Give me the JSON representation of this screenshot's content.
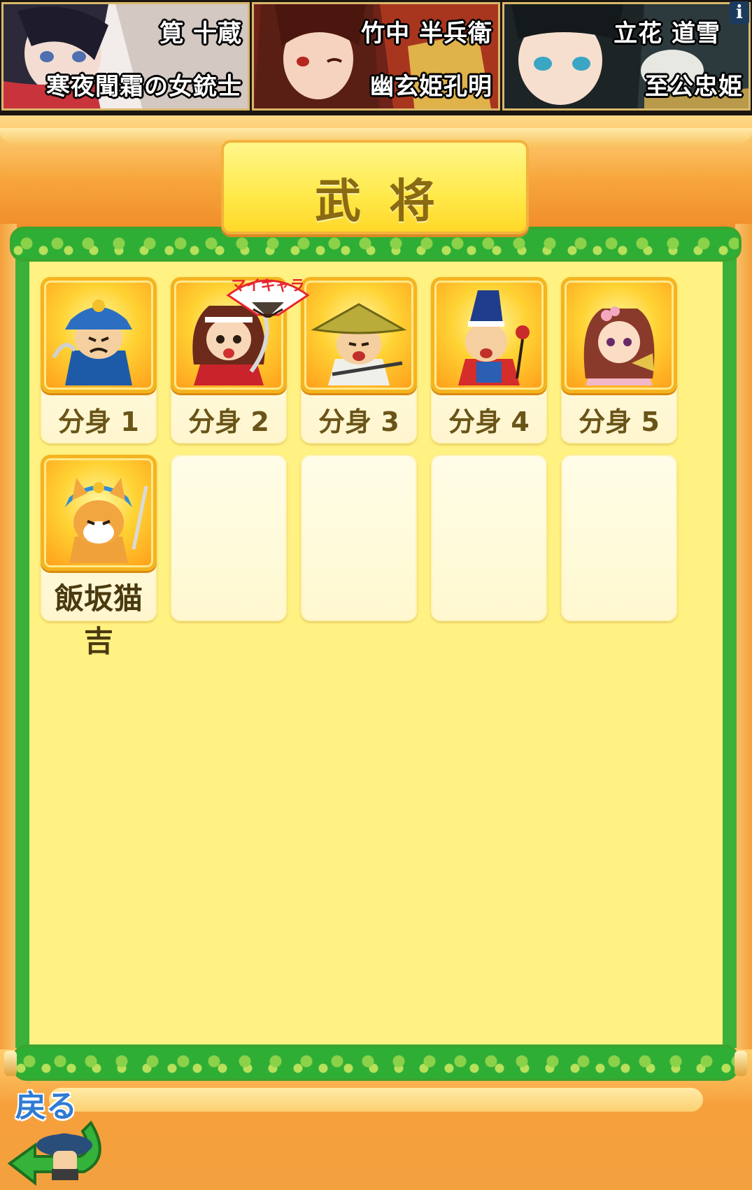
{
  "banner": {
    "cards": [
      {
        "name": "筧 十蔵",
        "title": "寒夜聞霜の女銃士"
      },
      {
        "name": "竹中 半兵衛",
        "title": "幽玄姫孔明"
      },
      {
        "name": "立花 道雪",
        "title": "至公忠姫"
      }
    ],
    "info_label": "i"
  },
  "page": {
    "title": "武将"
  },
  "my_character_badge": "マイキャラ",
  "characters": [
    {
      "label": "分身 1",
      "icon": "blue-samurai-portrait"
    },
    {
      "label": "分身 2",
      "icon": "kunoichi-portrait"
    },
    {
      "label": "分身 3",
      "icon": "straw-hat-monk-portrait"
    },
    {
      "label": "分身 4",
      "icon": "court-noble-portrait"
    },
    {
      "label": "分身 5",
      "icon": "princess-portrait"
    },
    {
      "label": "飯坂猫吉",
      "icon": "samurai-cat-portrait"
    }
  ],
  "back_button": {
    "label": "戻る"
  },
  "colors": {
    "frame": "#f6b44a",
    "scroll_border": "#3cb13a",
    "paper": "#fff182",
    "plate": "#ffe94a",
    "label": "#6a5418"
  }
}
